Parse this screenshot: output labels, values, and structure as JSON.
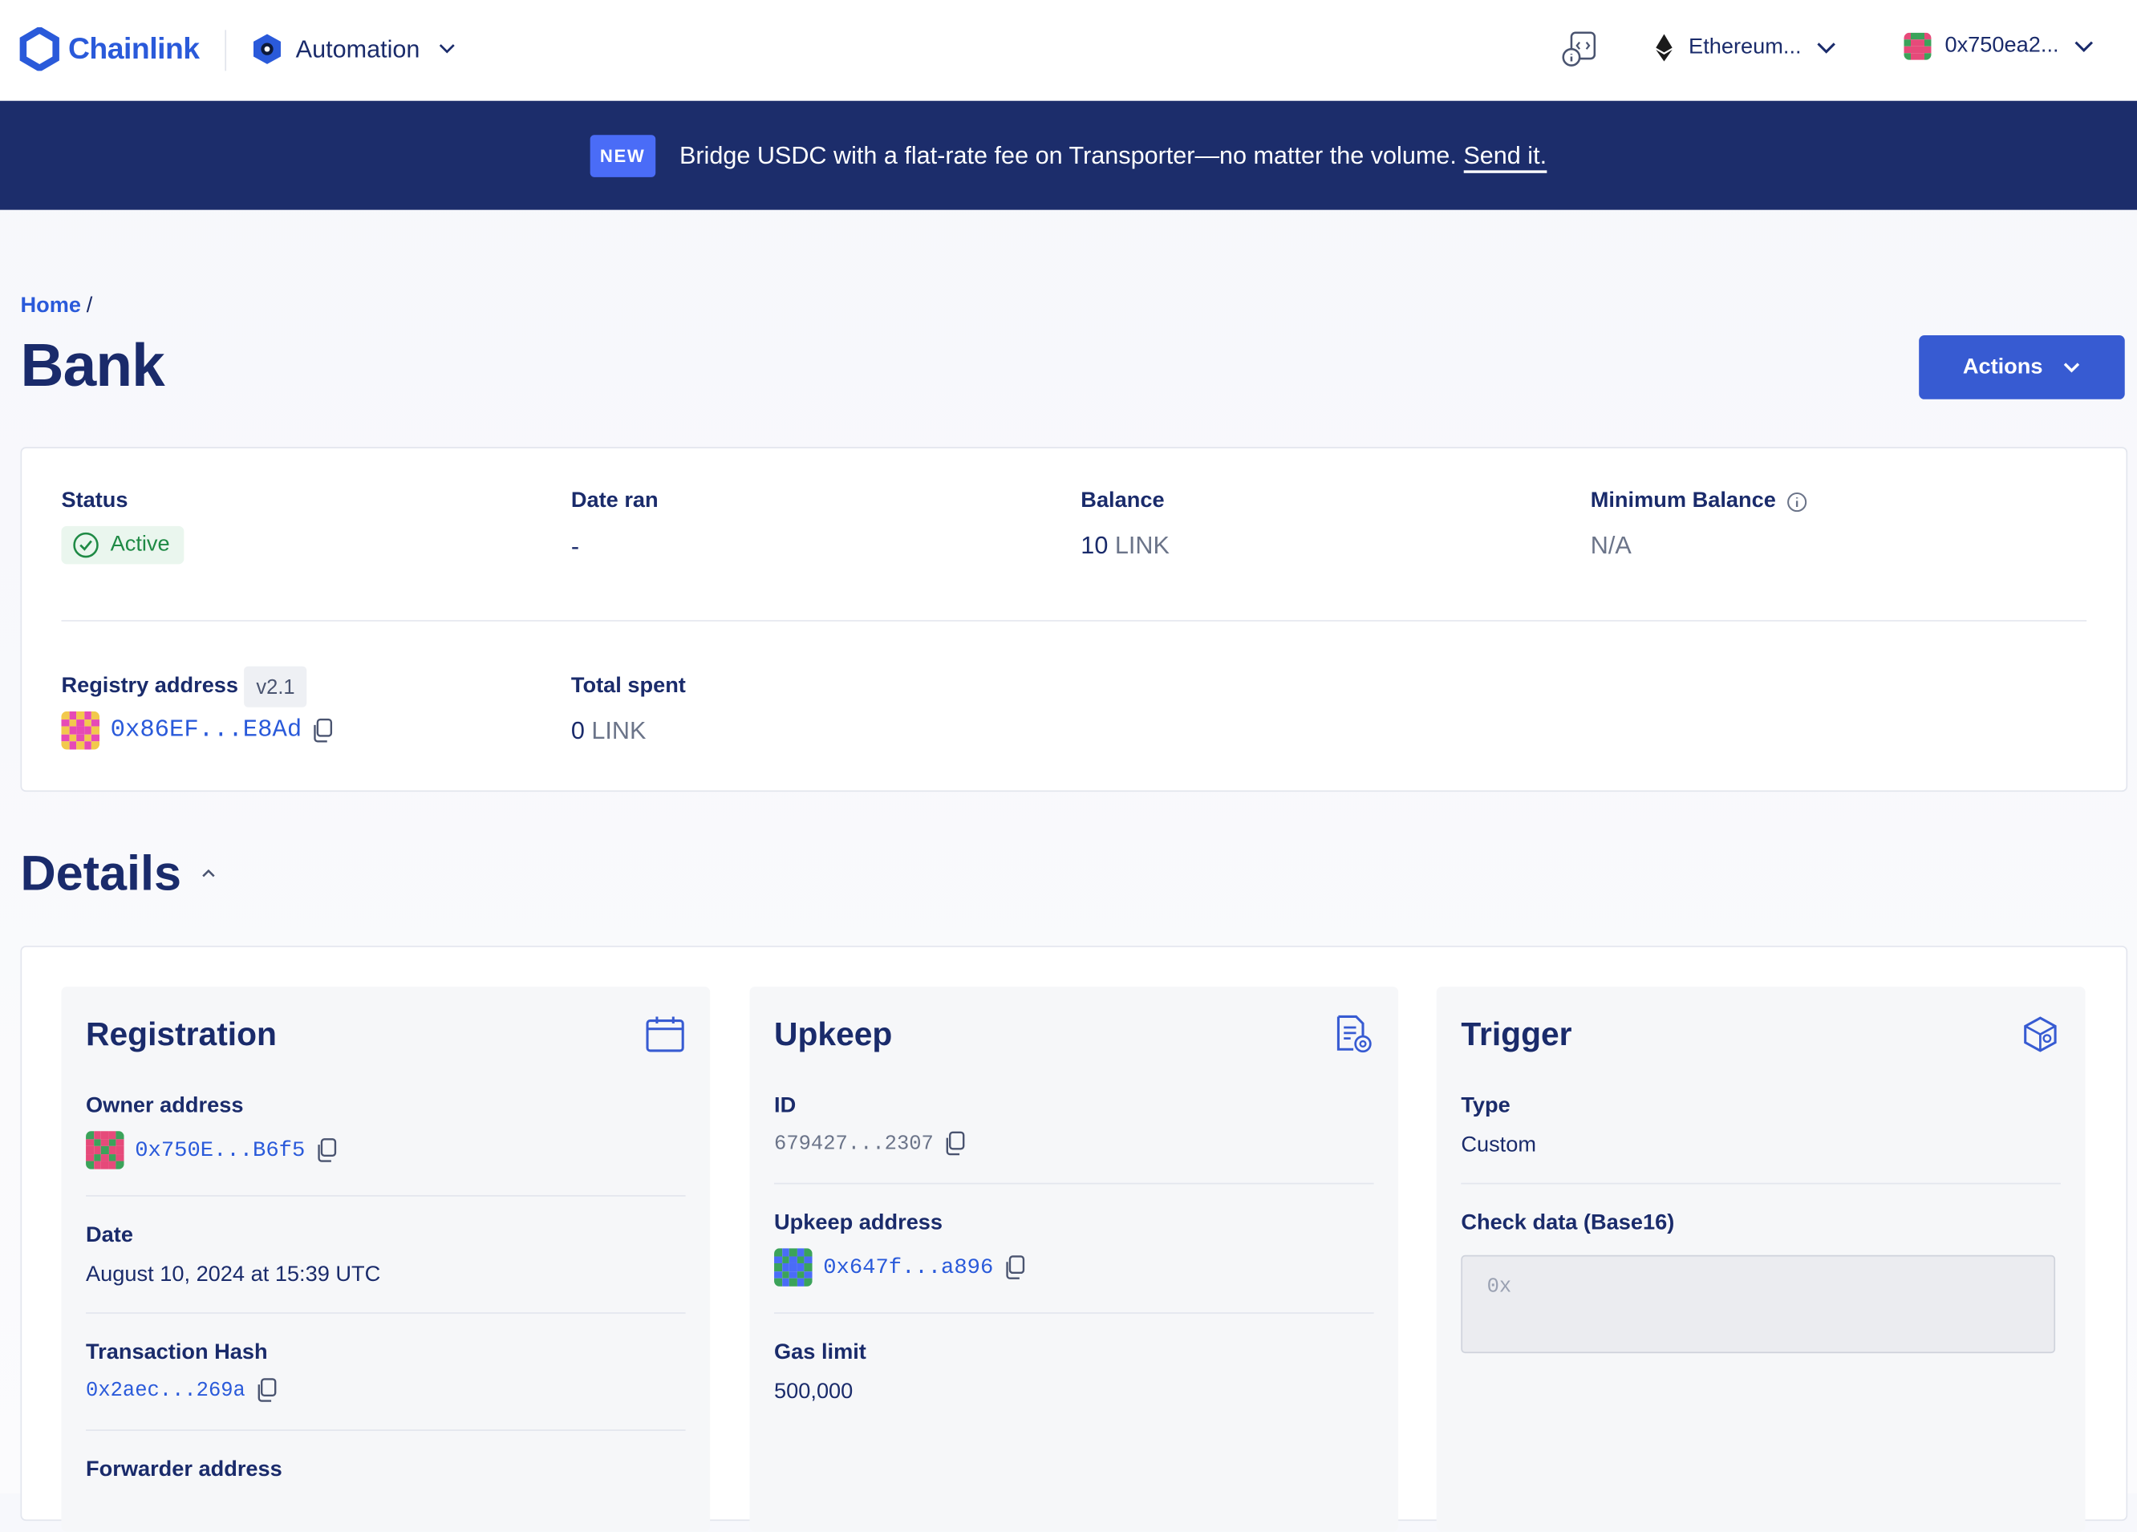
{
  "header": {
    "brand": "Chainlink",
    "product": "Automation",
    "network": "Ethereum...",
    "wallet": "0x750ea2..."
  },
  "banner": {
    "badge": "NEW",
    "message": "Bridge USDC with a flat-rate fee on Transporter—no matter the volume.",
    "link": "Send it."
  },
  "breadcrumb": {
    "home": "Home",
    "separator": "/"
  },
  "page": {
    "title": "Bank",
    "actions_label": "Actions"
  },
  "summary": {
    "status_label": "Status",
    "status_value": "Active",
    "date_ran_label": "Date ran",
    "date_ran_value": "-",
    "balance_label": "Balance",
    "balance_amount": "10",
    "balance_unit": "LINK",
    "min_balance_label": "Minimum Balance",
    "min_balance_value": "N/A",
    "registry_label": "Registry address",
    "registry_version": "v2.1",
    "registry_address": "0x86EF...E8Ad",
    "total_spent_label": "Total spent",
    "total_spent_amount": "0",
    "total_spent_unit": "LINK"
  },
  "details": {
    "title": "Details",
    "registration": {
      "title": "Registration",
      "owner_label": "Owner address",
      "owner_address": "0x750E...B6f5",
      "date_label": "Date",
      "date_value": "August 10, 2024 at 15:39 UTC",
      "tx_label": "Transaction Hash",
      "tx_value": "0x2aec...269a",
      "forwarder_label": "Forwarder address"
    },
    "upkeep": {
      "title": "Upkeep",
      "id_label": "ID",
      "id_value": "679427...2307",
      "address_label": "Upkeep address",
      "address_value": "0x647f...a896",
      "gas_label": "Gas limit",
      "gas_value": "500,000"
    },
    "trigger": {
      "title": "Trigger",
      "type_label": "Type",
      "type_value": "Custom",
      "check_label": "Check data (Base16)",
      "check_placeholder": "0x"
    }
  },
  "colors": {
    "primary": "#375bd2",
    "navy": "#1a2b6b",
    "banner": "#1c2d6b",
    "success": "#1f8a45"
  }
}
